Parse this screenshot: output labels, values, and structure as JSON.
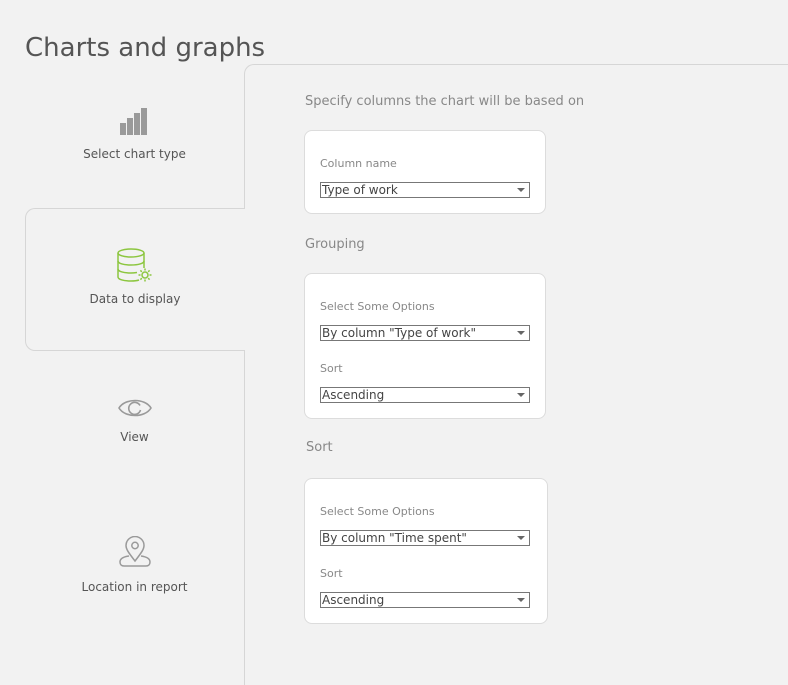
{
  "page": {
    "title": "Charts and graphs"
  },
  "nav": {
    "items": [
      {
        "label": "Select chart type",
        "icon": "bar-chart-icon",
        "active": false
      },
      {
        "label": "Data to display",
        "icon": "database-gear-icon",
        "active": true
      },
      {
        "label": "View",
        "icon": "eye-icon",
        "active": false
      },
      {
        "label": "Location in report",
        "icon": "map-pin-icon",
        "active": false
      }
    ]
  },
  "main": {
    "columns": {
      "heading": "Specify columns the chart will be based on",
      "column_name_label": "Column name",
      "column_name_value": "Type of work"
    },
    "grouping": {
      "heading": "Grouping",
      "options_label": "Select Some Options",
      "options_value": "By column \"Type of work\"",
      "sort_label": "Sort",
      "sort_value": "Ascending"
    },
    "sort": {
      "heading": "Sort",
      "options_label": "Select Some Options",
      "options_value": "By column \"Time spent\"",
      "sort_label": "Sort",
      "sort_value": "Ascending"
    }
  },
  "colors": {
    "accent": "#8cc63f",
    "icon_gray": "#999999",
    "background": "#f2f2f2"
  }
}
